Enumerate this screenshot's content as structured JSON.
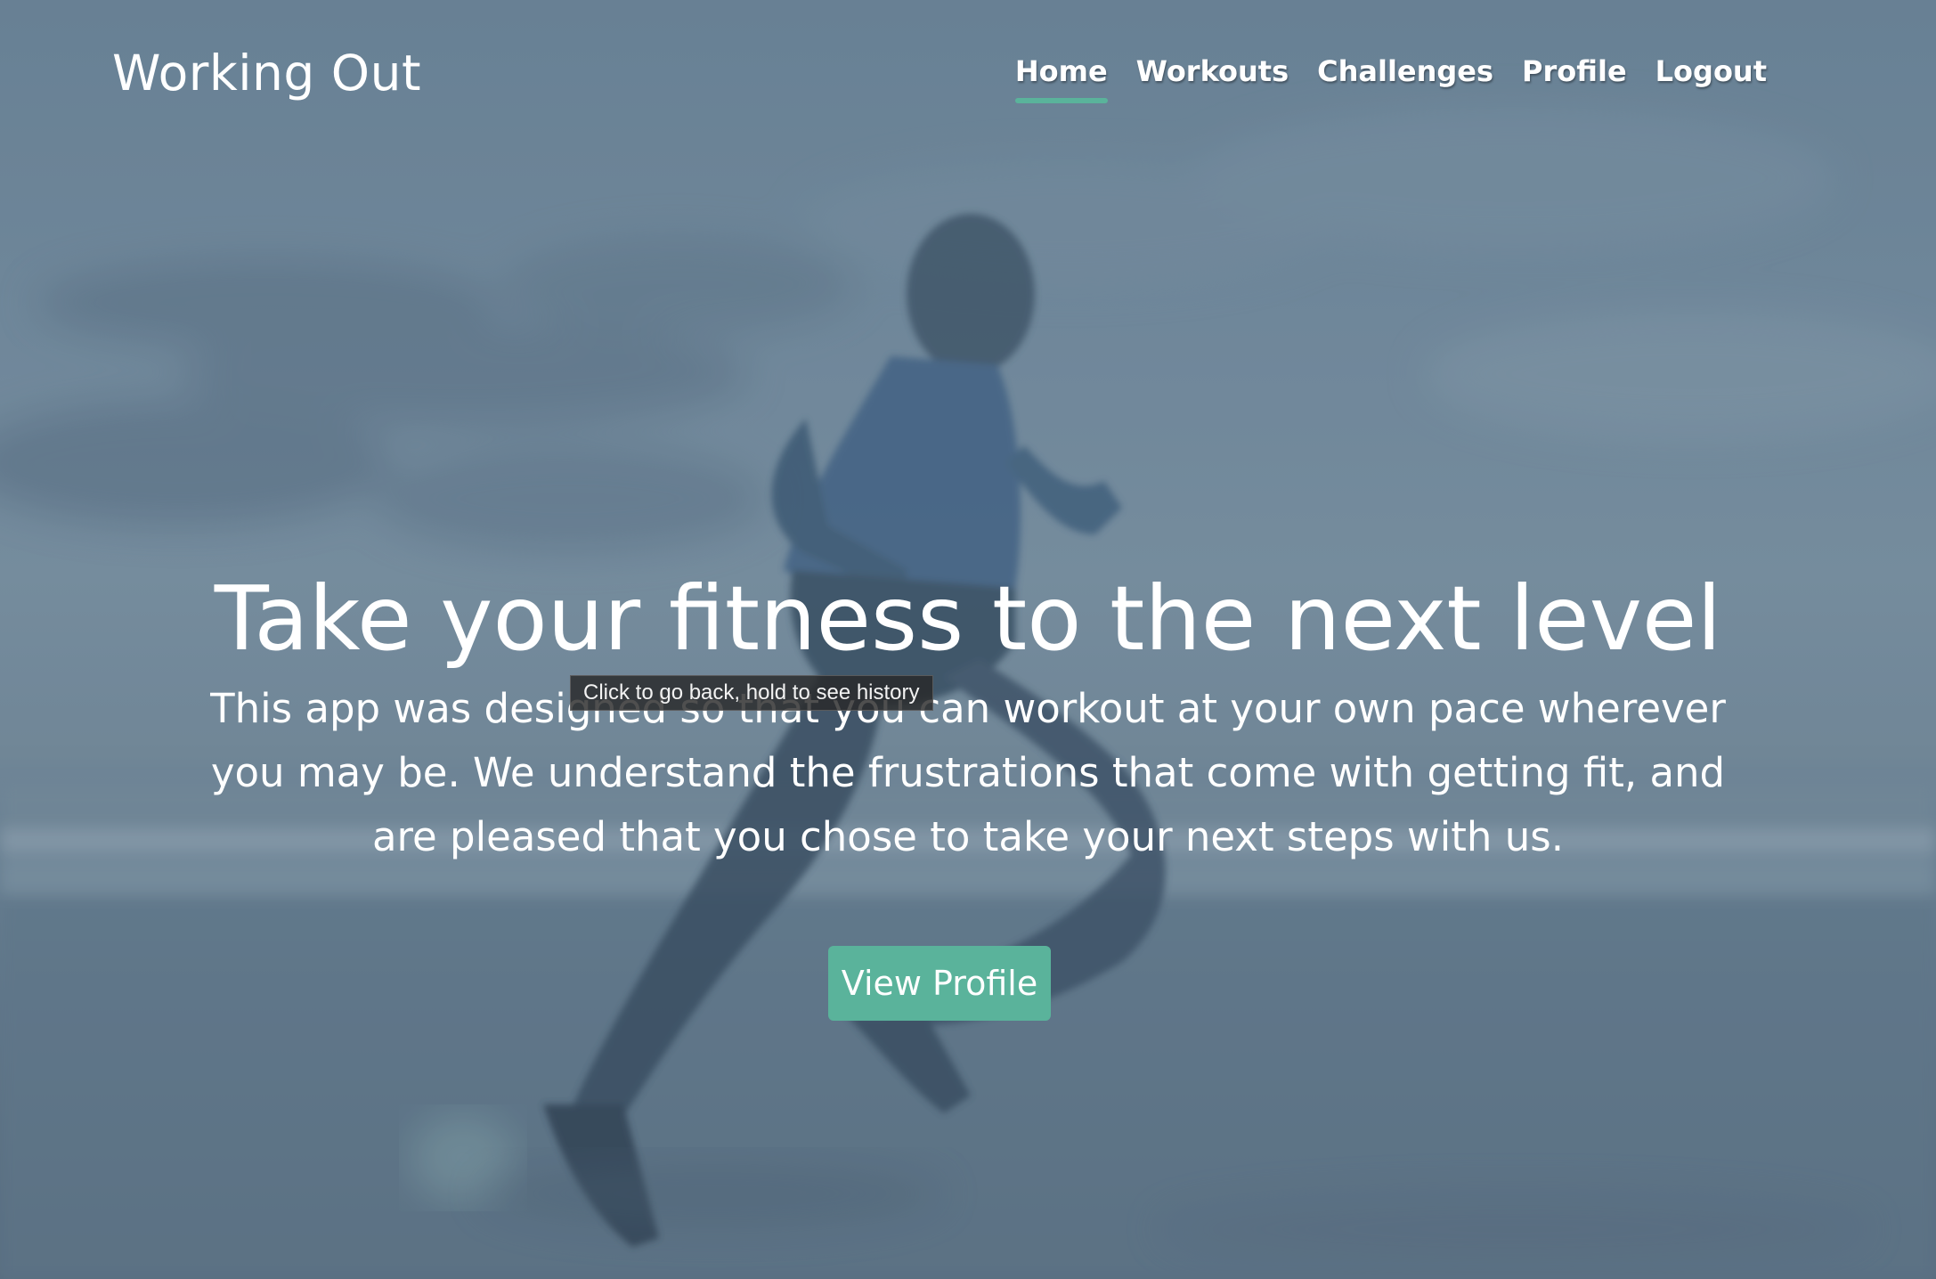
{
  "brand": {
    "name": "Working Out"
  },
  "nav": {
    "items": [
      {
        "label": "Home",
        "active": true
      },
      {
        "label": "Workouts",
        "active": false
      },
      {
        "label": "Challenges",
        "active": false
      },
      {
        "label": "Profile",
        "active": false
      },
      {
        "label": "Logout",
        "active": false
      }
    ]
  },
  "hero": {
    "title": "Take your fitness to the next level",
    "description": "This app was designed so that you can workout at your own pace wherever you may be. We understand the frustrations that come with getting fit, and are pleased that you chose to take your next steps with us.",
    "button_label": "View Profile"
  },
  "tooltip": {
    "text": "Click to go back, hold to see history"
  },
  "colors": {
    "accent": "#5ab39b",
    "text": "#ffffff",
    "tooltip_bg": "#2b2b2b"
  },
  "icons": {
    "background": "runner-on-beach-photo"
  }
}
